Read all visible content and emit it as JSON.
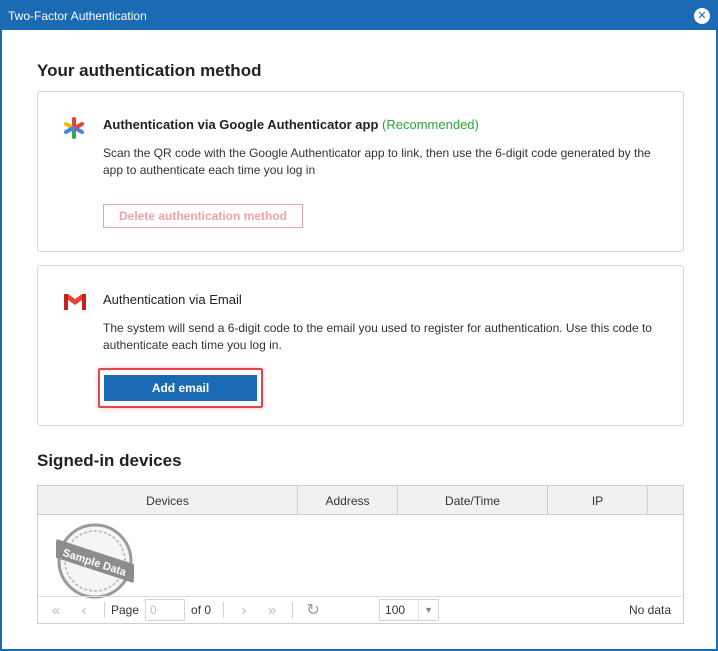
{
  "window": {
    "title": "Two-Factor Authentication"
  },
  "sections": {
    "auth_method_title": "Your authentication method",
    "devices_title": "Signed-in devices"
  },
  "google_card": {
    "heading": "Authentication via Google Authenticator app",
    "recommended": "(Recommended)",
    "description": "Scan the QR code with the Google Authenticator app to link, then use the 6-digit code generated by the app to authenticate each time you log in",
    "delete_button": "Delete authentication method"
  },
  "email_card": {
    "heading": "Authentication via Email",
    "description": "The system will send a 6-digit code to the email you used to register for authentication. Use this code to authenticate each time you log in.",
    "add_button": "Add email"
  },
  "devices_grid": {
    "columns": [
      "Devices",
      "Address",
      "Date/Time",
      "IP"
    ],
    "stamp_text": "Sample Data",
    "pager": {
      "page_label": "Page",
      "page_value": "0",
      "of_label": "of 0",
      "page_size": "100",
      "status": "No data"
    }
  },
  "colors": {
    "primary": "#1a6ab4",
    "recommended": "#2ba63b",
    "danger_outline": "#f0a3a6",
    "highlight": "#e0484d"
  }
}
